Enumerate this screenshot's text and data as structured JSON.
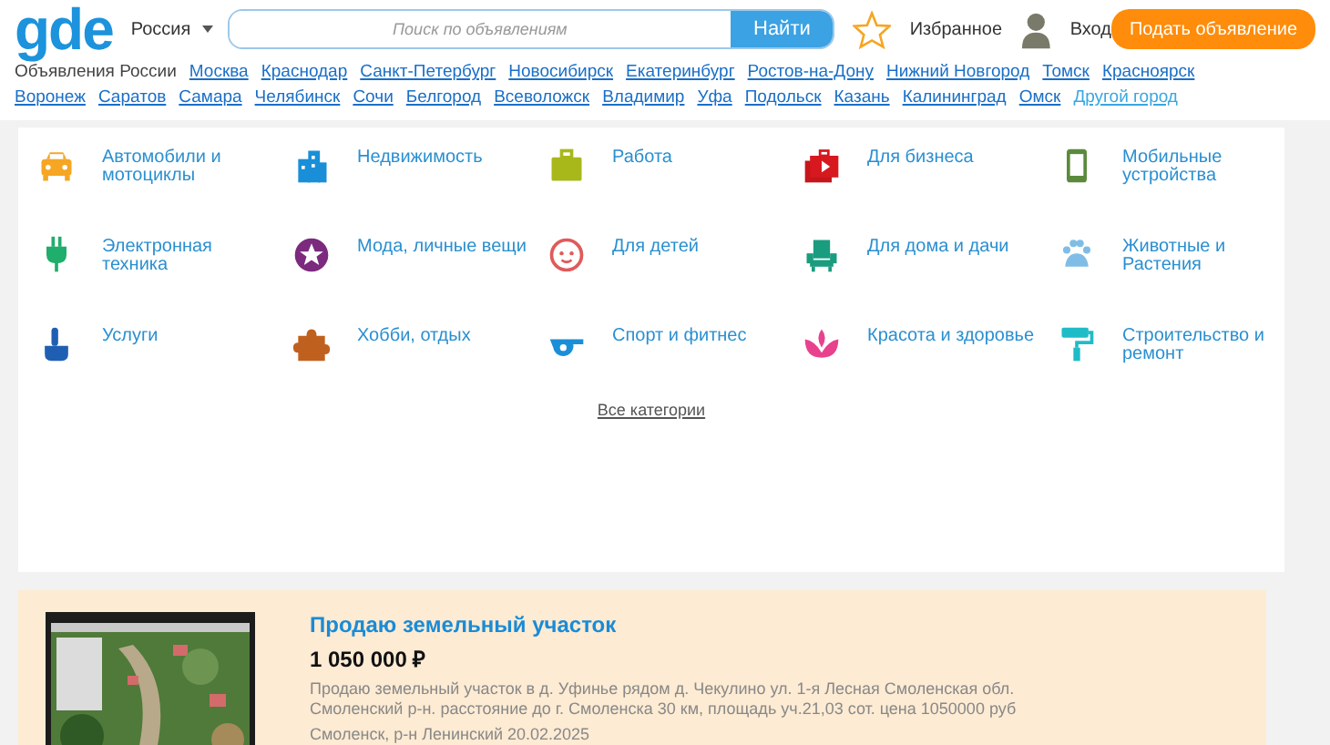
{
  "header": {
    "logo": "gde",
    "region": "Россия",
    "search": {
      "placeholder": "Поиск по объявлениям",
      "button": "Найти"
    },
    "favorites": "Избранное",
    "login": "Вход",
    "post_button": "Подать объявление"
  },
  "cities": {
    "label": "Объявления России",
    "links": [
      "Москва",
      "Краснодар",
      "Санкт-Петербург",
      "Новосибирск",
      "Екатеринбург",
      "Ростов-на-Дону",
      "Нижний Новгород",
      "Томск",
      "Красноярск",
      "Воронеж",
      "Саратов",
      "Самара",
      "Челябинск",
      "Сочи",
      "Белгород",
      "Всеволожск",
      "Владимир",
      "Уфа",
      "Подольск",
      "Казань",
      "Калининград",
      "Омск"
    ],
    "other": "Другой город"
  },
  "categories": [
    {
      "label": "Автомобили и мотоциклы"
    },
    {
      "label": "Недвижимость"
    },
    {
      "label": "Работа"
    },
    {
      "label": "Для бизнеса"
    },
    {
      "label": "Мобильные устройства"
    },
    {
      "label": "Электронная техника"
    },
    {
      "label": "Мода, личные вещи"
    },
    {
      "label": "Для детей"
    },
    {
      "label": "Для дома и дачи"
    },
    {
      "label": "Животные и Растения"
    },
    {
      "label": "Услуги"
    },
    {
      "label": "Хобби, отдых"
    },
    {
      "label": "Спорт и фитнес"
    },
    {
      "label": "Красота и здоровье"
    },
    {
      "label": "Строительство и ремонт"
    }
  ],
  "all_categories": "Все категории",
  "listing": {
    "title": "Продаю земельный участок",
    "price": "1 050 000 ₽",
    "description": "Продаю земельный участок в д. Уфинье рядом д. Чекулино ул. 1-я Лесная Смоленская обл. Смоленский р-н. расстояние до г. Смоленска 30 км, площадь уч.21,03 сот. цена 1050000 руб",
    "meta": "Смоленск, р-н Ленинский 20.02.2025"
  }
}
